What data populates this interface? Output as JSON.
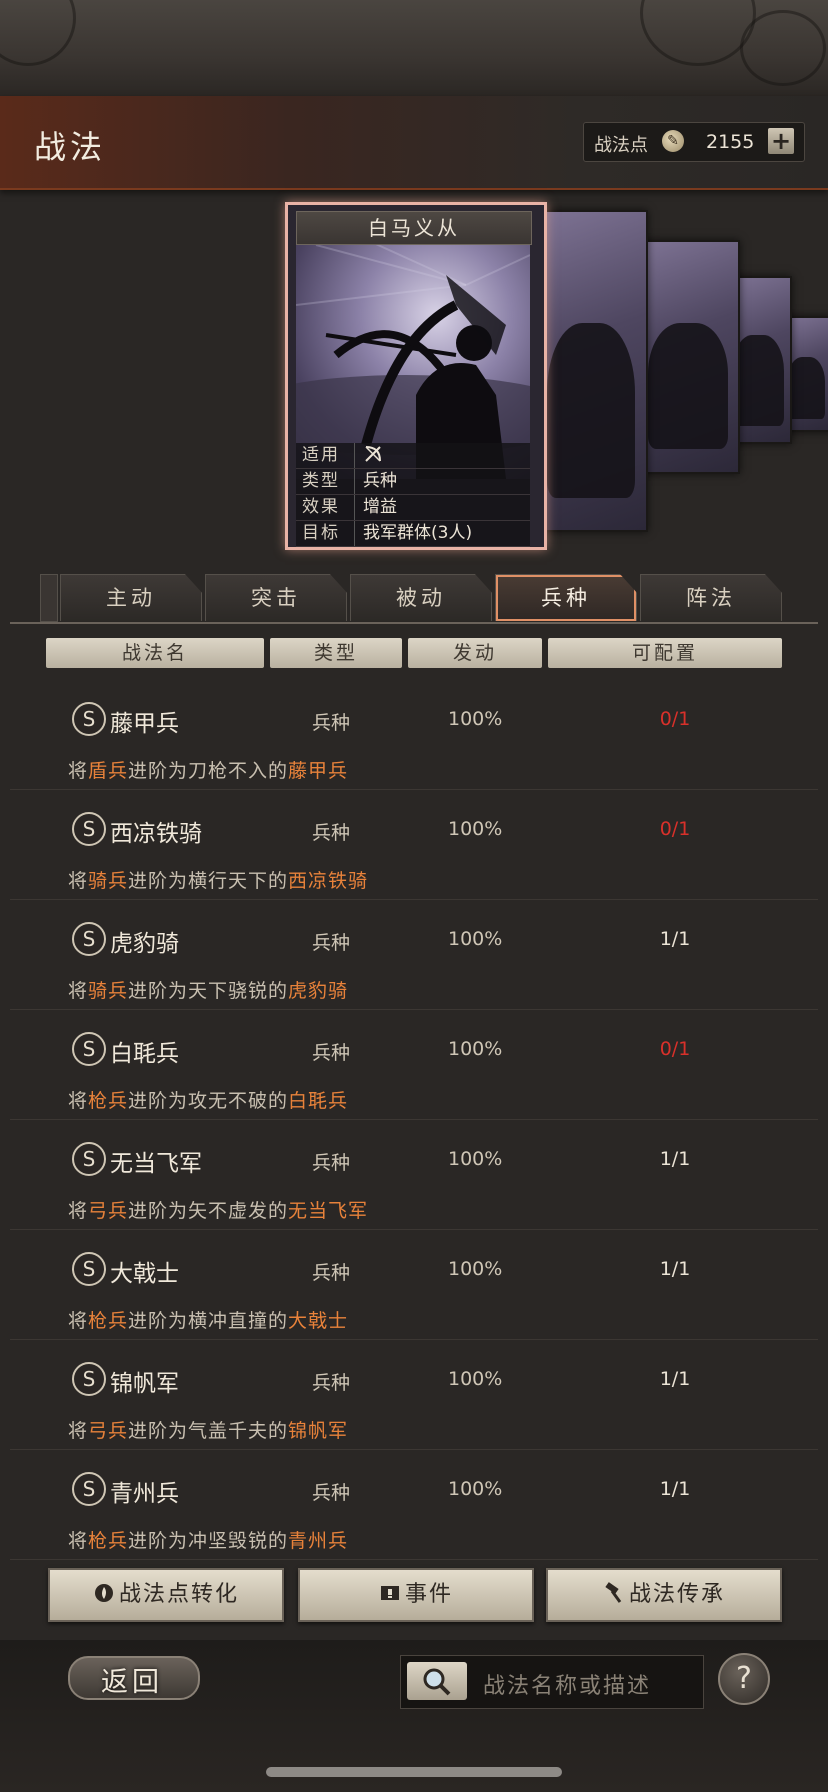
{
  "header": {
    "title": "战法",
    "points_label": "战法点",
    "points_value": "2155",
    "add_label": "+"
  },
  "card": {
    "name": "白马义从",
    "attributes": [
      {
        "key": "适用",
        "value": ""
      },
      {
        "key": "类型",
        "value": "兵种"
      },
      {
        "key": "效果",
        "value": "增益"
      },
      {
        "key": "目标",
        "value": "我军群体(3人)"
      }
    ]
  },
  "tabs": [
    "主动",
    "突击",
    "被动",
    "兵种",
    "阵法"
  ],
  "active_tab": "兵种",
  "columns": [
    "战法名",
    "类型",
    "发动",
    "可配置"
  ],
  "rows": [
    {
      "badge": "S",
      "name": "藤甲兵",
      "type": "兵种",
      "rate": "100%",
      "count": "0/1",
      "count_color": "#d8302a",
      "desc_pre": "将",
      "desc_hl1": "盾兵",
      "desc_mid": "进阶为刀枪不入的",
      "desc_hl2": "藤甲兵"
    },
    {
      "badge": "S",
      "name": "西凉铁骑",
      "type": "兵种",
      "rate": "100%",
      "count": "0/1",
      "count_color": "#d8302a",
      "desc_pre": "将",
      "desc_hl1": "骑兵",
      "desc_mid": "进阶为横行天下的",
      "desc_hl2": "西凉铁骑"
    },
    {
      "badge": "S",
      "name": "虎豹骑",
      "type": "兵种",
      "rate": "100%",
      "count": "1/1",
      "count_color": "#ece4d6",
      "desc_pre": "将",
      "desc_hl1": "骑兵",
      "desc_mid": "进阶为天下骁锐的",
      "desc_hl2": "虎豹骑"
    },
    {
      "badge": "S",
      "name": "白毦兵",
      "type": "兵种",
      "rate": "100%",
      "count": "0/1",
      "count_color": "#d8302a",
      "desc_pre": "将",
      "desc_hl1": "枪兵",
      "desc_mid": "进阶为攻无不破的",
      "desc_hl2": "白毦兵"
    },
    {
      "badge": "S",
      "name": "无当飞军",
      "type": "兵种",
      "rate": "100%",
      "count": "1/1",
      "count_color": "#ece4d6",
      "desc_pre": "将",
      "desc_hl1": "弓兵",
      "desc_mid": "进阶为矢不虚发的",
      "desc_hl2": "无当飞军"
    },
    {
      "badge": "S",
      "name": "大戟士",
      "type": "兵种",
      "rate": "100%",
      "count": "1/1",
      "count_color": "#ece4d6",
      "desc_pre": "将",
      "desc_hl1": "枪兵",
      "desc_mid": "进阶为横冲直撞的",
      "desc_hl2": "大戟士"
    },
    {
      "badge": "S",
      "name": "锦帆军",
      "type": "兵种",
      "rate": "100%",
      "count": "1/1",
      "count_color": "#ece4d6",
      "desc_pre": "将",
      "desc_hl1": "弓兵",
      "desc_mid": "进阶为气盖千夫的",
      "desc_hl2": "锦帆军"
    },
    {
      "badge": "S",
      "name": "青州兵",
      "type": "兵种",
      "rate": "100%",
      "count": "1/1",
      "count_color": "#ece4d6",
      "desc_pre": "将",
      "desc_hl1": "枪兵",
      "desc_mid": "进阶为冲坚毁锐的",
      "desc_hl2": "青州兵"
    }
  ],
  "buttons": {
    "convert": "战法点转化",
    "events": "事件",
    "inherit": "战法传承"
  },
  "footer": {
    "back": "返回",
    "search_placeholder": "战法名称或描述",
    "help": "?"
  },
  "icons": [
    "coin-icon",
    "plus-icon",
    "bow-icon",
    "flame-icon",
    "scroll-icon",
    "hammer-icon",
    "search-icon",
    "help-icon"
  ],
  "colors": {
    "highlight": "#e8823a",
    "unavailable": "#d8302a",
    "active_tab_border": "#e09066"
  }
}
